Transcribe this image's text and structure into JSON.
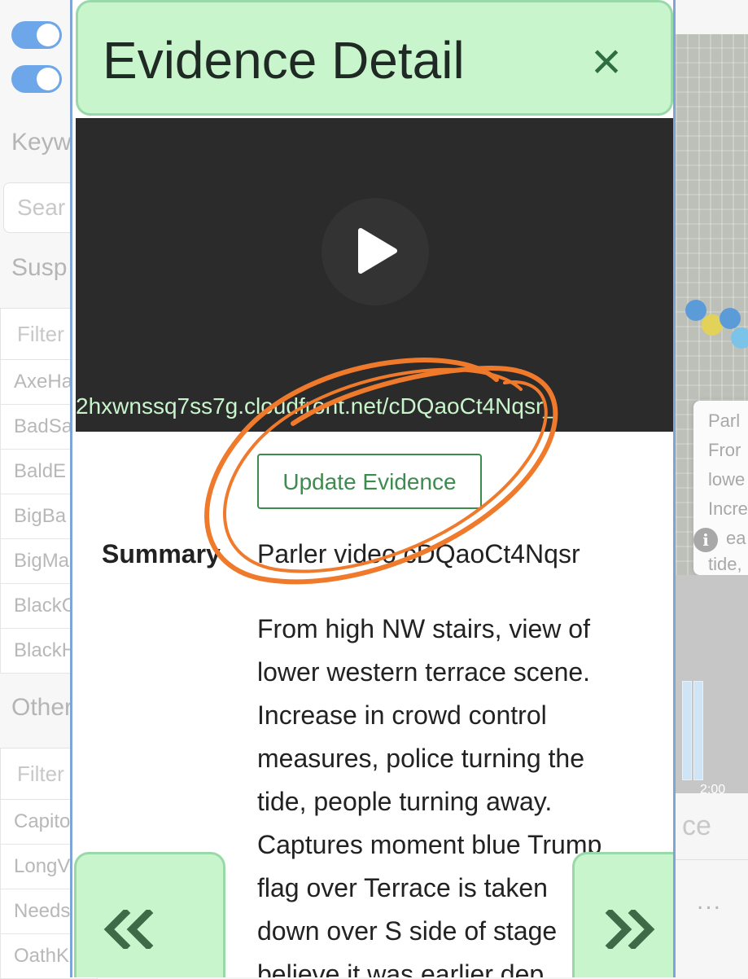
{
  "background_left": {
    "keywords_heading": "Keyw",
    "search_placeholder": "Sear",
    "suspects_heading": "Susp",
    "suspects_filter": "Filter",
    "suspects_list": [
      "AxeHa",
      "BadSa",
      "BaldE",
      "BigBa",
      "BigMa",
      "BlackC",
      "BlackH"
    ],
    "other_heading": "Other",
    "other_filter": "Filter",
    "other_list": [
      "Capito",
      "LongV",
      "Needs",
      "OathK"
    ]
  },
  "background_right": {
    "card_lines": [
      "Parl",
      "Fror",
      "lowe",
      "Incre",
      "ea",
      "tide,"
    ],
    "timestamp": "2:00",
    "section_text": "ce",
    "more": "..."
  },
  "modal": {
    "title": "Evidence Detail",
    "close_symbol": "×",
    "video_url": "2hxwnssq7ss7g.cloudfront.net/cDQaoCt4Nqsr_",
    "update_button": "Update Evidence",
    "summary_label": "Summary",
    "summary_title": "Parler video cDQaoCt4Nqsr",
    "summary_lines": [
      "From high NW stairs, view of",
      "lower western terrace scene.",
      "Increase in crowd control",
      "measures, police turning the",
      "tide, people turning away.",
      "Captures moment blue Trump",
      "flag over Terrace is taken",
      "down over S side of stage",
      "believe it was earlier dep"
    ],
    "prev_symbol": "«",
    "next_symbol": "»"
  },
  "colors": {
    "header_bg": "#c8f5cc",
    "header_border": "#99d9a7",
    "accent_green": "#3d8b4e",
    "video_bg": "#2b2b2b",
    "annotation_orange": "#f07a2b"
  },
  "icons": [
    "close-icon",
    "play-icon",
    "chevron-double-left-icon",
    "chevron-double-right-icon",
    "info-icon"
  ]
}
